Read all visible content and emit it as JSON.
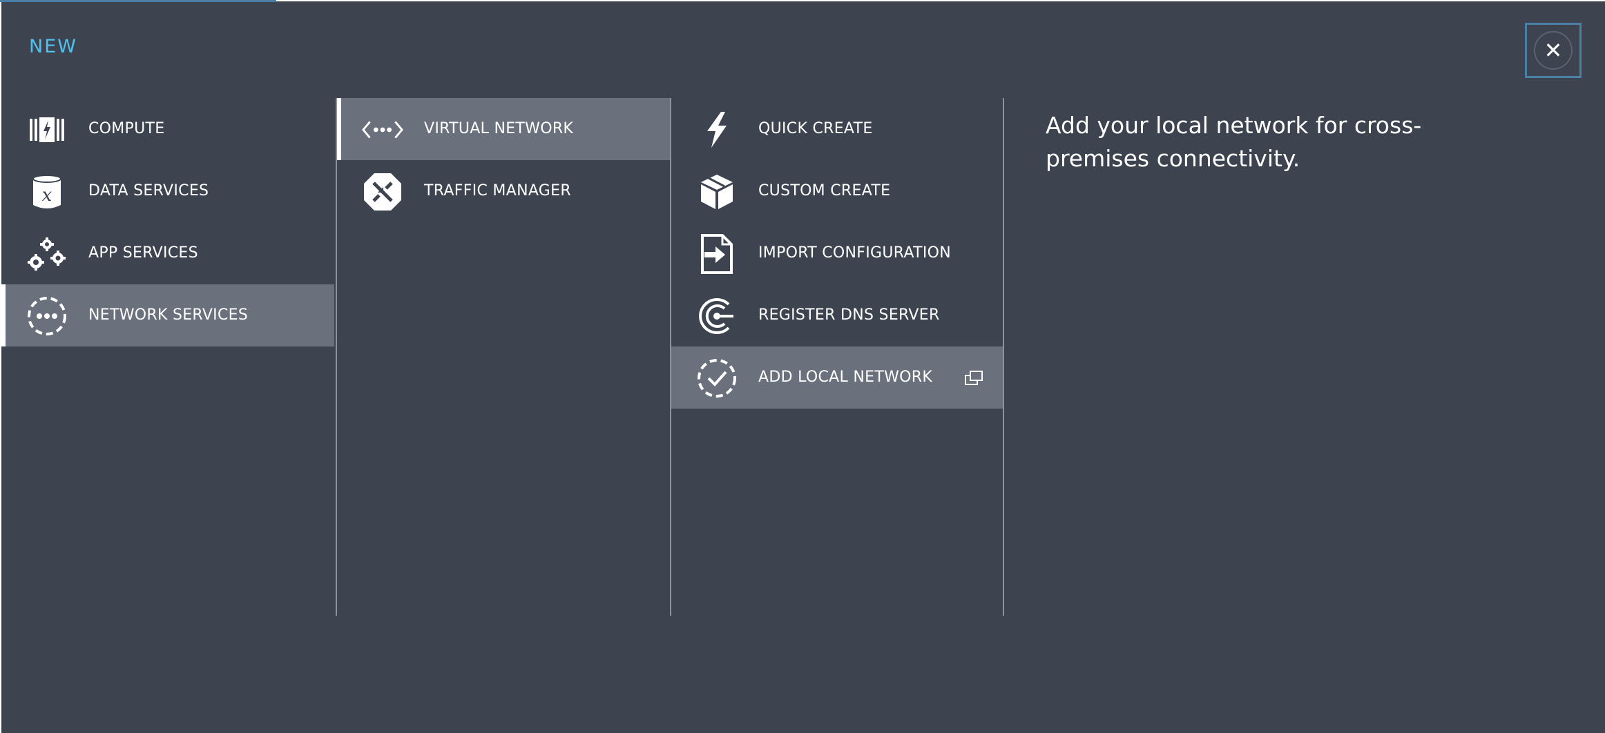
{
  "header": {
    "title": "NEW",
    "close_icon": "close-icon"
  },
  "categories": [
    {
      "label": "COMPUTE",
      "icon": "compute-icon"
    },
    {
      "label": "DATA SERVICES",
      "icon": "database-icon"
    },
    {
      "label": "APP SERVICES",
      "icon": "gears-icon"
    },
    {
      "label": "NETWORK SERVICES",
      "icon": "network-icon",
      "selected": true
    }
  ],
  "services": [
    {
      "label": "VIRTUAL NETWORK",
      "icon": "virtual-network-icon",
      "selected": true
    },
    {
      "label": "TRAFFIC MANAGER",
      "icon": "traffic-manager-icon"
    }
  ],
  "actions": [
    {
      "label": "QUICK CREATE",
      "icon": "lightning-icon"
    },
    {
      "label": "CUSTOM CREATE",
      "icon": "box-icon"
    },
    {
      "label": "IMPORT CONFIGURATION",
      "icon": "import-file-icon"
    },
    {
      "label": "REGISTER DNS SERVER",
      "icon": "dns-icon"
    },
    {
      "label": "ADD LOCAL NETWORK",
      "icon": "local-network-check-icon",
      "selected": true,
      "trailing_icon": "popout-icon"
    }
  ],
  "description": "Add your local network for cross-premises connectivity.",
  "colors": {
    "background": "#3d4450",
    "selected": "#6a717c",
    "accent": "#4fc1f0",
    "close_border": "#4a7fa8"
  }
}
